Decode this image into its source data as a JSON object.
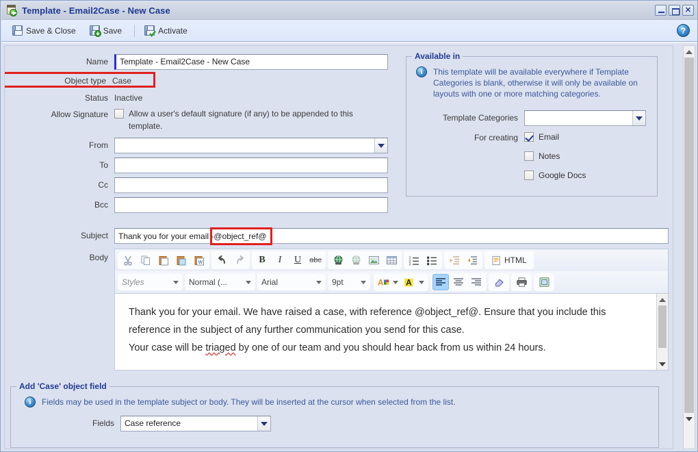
{
  "window": {
    "title": "Template - Email2Case - New Case",
    "icon": "template-new-icon",
    "minimize_label": "–",
    "maximize_label": "",
    "close_label": "✕"
  },
  "toolbar": {
    "save_close_label": "Save & Close",
    "save_label": "Save",
    "activate_label": "Activate",
    "help_label": "?"
  },
  "form": {
    "name_label": "Name",
    "name_value": "Template - Email2Case - New Case",
    "object_type_label": "Object type",
    "object_type_value": "Case",
    "status_label": "Status",
    "status_value": "Inactive",
    "allow_signature_label": "Allow Signature",
    "allow_signature_text": "Allow a user's default signature (if any) to be appended to this template.",
    "from_label": "From",
    "from_value": "",
    "to_label": "To",
    "to_value": "",
    "cc_label": "Cc",
    "cc_value": "",
    "bcc_label": "Bcc",
    "bcc_value": "",
    "subject_label": "Subject",
    "subject_value_1": "Thank you for your email - ",
    "subject_value_2": "@object_ref@",
    "body_label": "Body"
  },
  "available_in": {
    "title": "Available in",
    "info_text": "This template will be available everywhere if Template Categories is blank, otherwise it will only be available on layouts with one or more matching categories.",
    "template_categories_label": "Template Categories",
    "template_categories_value": "",
    "for_creating_label": "For creating",
    "checkboxes": [
      {
        "label": "Email",
        "checked": true
      },
      {
        "label": "Notes",
        "checked": false
      },
      {
        "label": "Google Docs",
        "checked": false
      }
    ]
  },
  "rte": {
    "row1": [
      {
        "name": "cut-icon",
        "glyph": "✂"
      },
      {
        "name": "copy-icon",
        "glyph": "⧉"
      },
      {
        "name": "paste-icon",
        "glyph": "ὌB"
      },
      {
        "name": "paste-as-text-icon",
        "glyph": "ὌB"
      },
      {
        "name": "paste-from-word-icon",
        "glyph": "W"
      },
      {
        "name": "undo-icon",
        "glyph": "↶"
      },
      {
        "name": "redo-icon",
        "glyph": "↷"
      },
      {
        "name": "bold-icon",
        "glyph": "B"
      },
      {
        "name": "italic-icon",
        "glyph": "I"
      },
      {
        "name": "underline-icon",
        "glyph": "U"
      },
      {
        "name": "strikethrough-icon",
        "glyph": "abc"
      },
      {
        "name": "link-icon",
        "glyph": "ἱ0"
      },
      {
        "name": "unlink-icon",
        "glyph": "ἱ0"
      },
      {
        "name": "image-icon",
        "glyph": "ὛC"
      },
      {
        "name": "table-icon",
        "glyph": "⌸"
      },
      {
        "name": "numbered-list-icon",
        "glyph": "1."
      },
      {
        "name": "bulleted-list-icon",
        "glyph": "•"
      },
      {
        "name": "outdent-icon",
        "glyph": "⇤"
      },
      {
        "name": "indent-icon",
        "glyph": "⇥"
      },
      {
        "name": "html-source-icon",
        "glyph": "HTML"
      }
    ],
    "html_label": "HTML",
    "styles_label": "Styles",
    "format_label": "Normal (...",
    "font_label": "Arial",
    "size_label": "9pt",
    "text_color_label": "A",
    "bg_color_label": "A",
    "align_left": "align-left-icon",
    "align_center": "align-center-icon",
    "align_right": "align-right-icon",
    "remove_format": "eraser-icon",
    "print": "printer-icon",
    "maximize": "maximize-editor-icon"
  },
  "editor": {
    "line1_a": "Thank you for your email. We have raised a case, with reference @object_ref@. Ensure that you include",
    "line1_b": "this reference in the subject of any further communication you send for this case.",
    "line2_a": "Your case will be ",
    "line2_misspelled": "triaged",
    "line2_b": " by one of our team and you should hear back from us within 24 hours."
  },
  "object_field": {
    "title": "Add 'Case' object field",
    "info_text": "Fields may be used in the template subject or body. They will be inserted at the cursor when selected from the list.",
    "fields_label": "Fields",
    "fields_value": "Case reference"
  },
  "colors": {
    "title_text": "#1f3a93",
    "window_bg": "#dce1ef",
    "titlebar_bg": "#ccd3e1",
    "toolbar_bg": "#dfe8fb",
    "highlight_red": "#e02020",
    "info_blue": "#3a5a9b",
    "active_blue": "#a8d4fb"
  }
}
